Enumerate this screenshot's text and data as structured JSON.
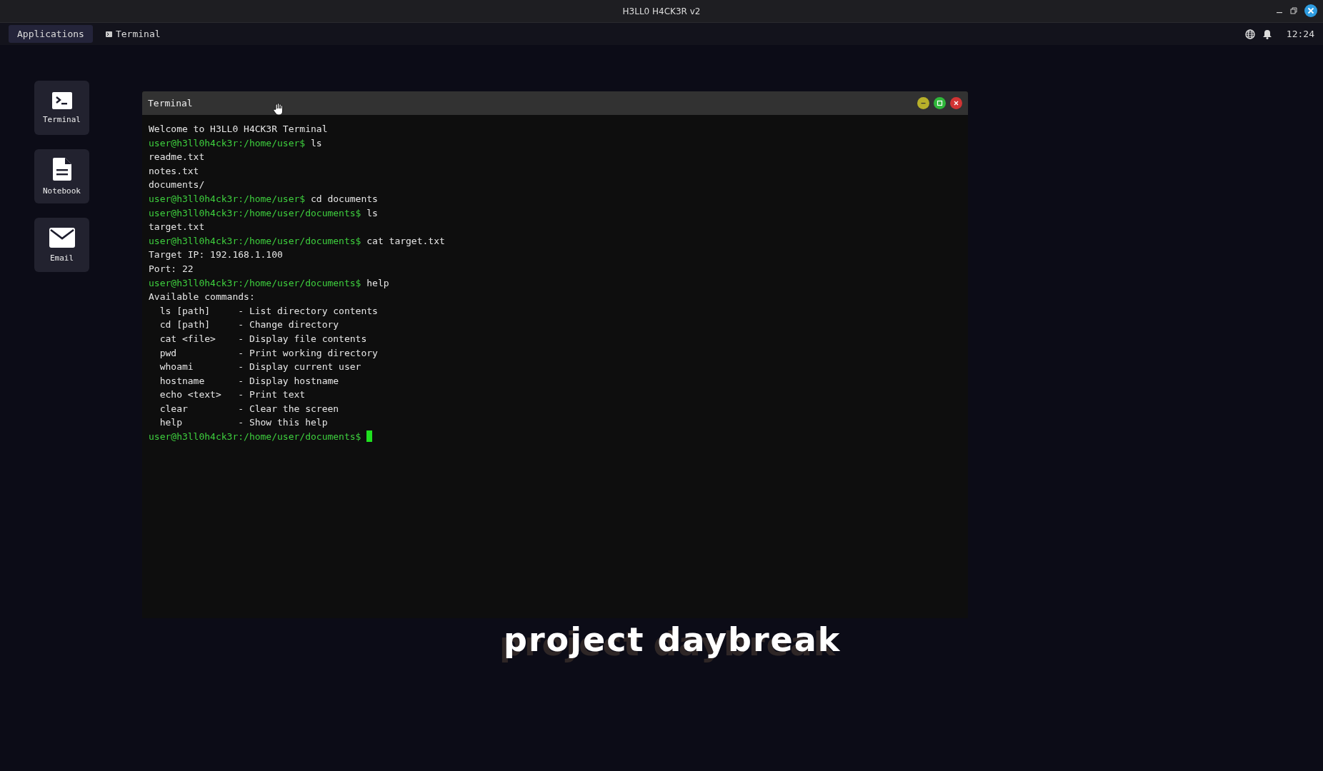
{
  "window": {
    "title": "H3LL0 H4CK3R v2"
  },
  "panel": {
    "menu_button": "Applications",
    "tasks": [
      {
        "label": "Terminal",
        "selected": false
      }
    ],
    "clock": "12:24"
  },
  "desktop_icons": [
    {
      "label": "Terminal",
      "kind": "terminal"
    },
    {
      "label": "Notebook",
      "kind": "notebook"
    },
    {
      "label": "Email",
      "kind": "email"
    }
  ],
  "wallpaper_text": "project daybreak",
  "terminal": {
    "title": "Terminal",
    "lines": [
      {
        "kind": "output",
        "text": "Welcome to H3LL0 H4CK3R Terminal"
      },
      {
        "kind": "prompt",
        "prompt": "user@h3ll0h4ck3r:/home/user$",
        "command": "ls",
        "cursor": false
      },
      {
        "kind": "output",
        "text": "readme.txt"
      },
      {
        "kind": "output",
        "text": "notes.txt"
      },
      {
        "kind": "output",
        "text": "documents/"
      },
      {
        "kind": "prompt",
        "prompt": "user@h3ll0h4ck3r:/home/user$",
        "command": "cd documents",
        "cursor": false
      },
      {
        "kind": "prompt",
        "prompt": "user@h3ll0h4ck3r:/home/user/documents$",
        "command": "ls",
        "cursor": false
      },
      {
        "kind": "output",
        "text": "target.txt"
      },
      {
        "kind": "prompt",
        "prompt": "user@h3ll0h4ck3r:/home/user/documents$",
        "command": "cat target.txt",
        "cursor": false
      },
      {
        "kind": "output",
        "text": "Target IP: 192.168.1.100"
      },
      {
        "kind": "output",
        "text": "Port: 22"
      },
      {
        "kind": "prompt",
        "prompt": "user@h3ll0h4ck3r:/home/user/documents$",
        "command": "help",
        "cursor": false
      },
      {
        "kind": "output",
        "text": "Available commands:"
      },
      {
        "kind": "output",
        "text": "  ls [path]     - List directory contents"
      },
      {
        "kind": "output",
        "text": "  cd [path]     - Change directory"
      },
      {
        "kind": "output",
        "text": "  cat <file>    - Display file contents"
      },
      {
        "kind": "output",
        "text": "  pwd           - Print working directory"
      },
      {
        "kind": "output",
        "text": "  whoami        - Display current user"
      },
      {
        "kind": "output",
        "text": "  hostname      - Display hostname"
      },
      {
        "kind": "output",
        "text": "  echo <text>   - Print text"
      },
      {
        "kind": "output",
        "text": "  clear         - Clear the screen"
      },
      {
        "kind": "output",
        "text": "  help          - Show this help"
      },
      {
        "kind": "prompt",
        "prompt": "user@h3ll0h4ck3r:/home/user/documents$",
        "cursor": true
      }
    ]
  }
}
